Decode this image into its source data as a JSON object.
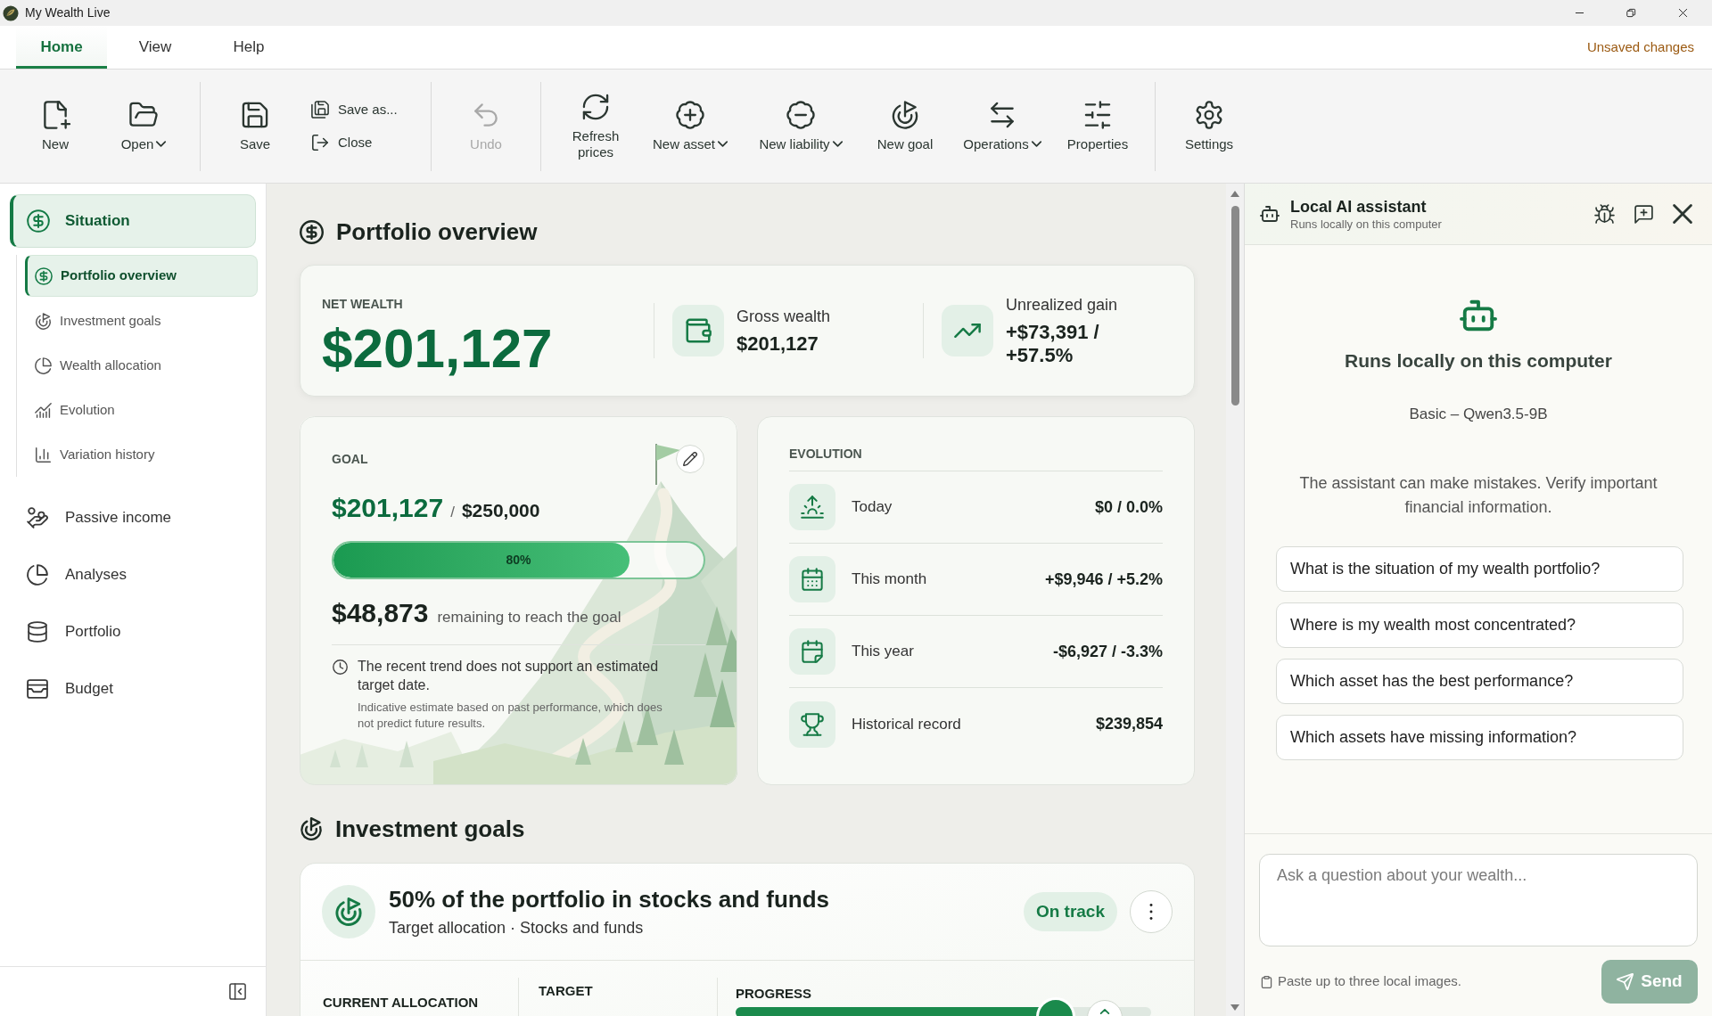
{
  "window": {
    "title": "My Wealth Live"
  },
  "tabs": [
    {
      "label": "Home",
      "selected": true
    },
    {
      "label": "View",
      "selected": false
    },
    {
      "label": "Help",
      "selected": false
    }
  ],
  "save_status": "Unsaved changes",
  "ribbon": [
    {
      "items": [
        {
          "kind": "large",
          "label": "New",
          "dropdown": false,
          "disabled": false
        },
        {
          "kind": "large",
          "label": "Open",
          "dropdown": true,
          "disabled": false
        }
      ]
    },
    {
      "items": [
        {
          "kind": "large",
          "label": "Save",
          "dropdown": false,
          "disabled": false
        },
        {
          "kind": "stack",
          "buttons": [
            {
              "label": "Save as...",
              "disabled": false
            },
            {
              "label": "Close",
              "disabled": false
            }
          ]
        }
      ]
    },
    {
      "items": [
        {
          "kind": "large",
          "label": "Undo",
          "dropdown": false,
          "disabled": true
        }
      ]
    },
    {
      "items": [
        {
          "kind": "large",
          "label": "Refresh prices",
          "dropdown": false,
          "disabled": false
        },
        {
          "kind": "large",
          "label": "New asset",
          "dropdown": true,
          "disabled": false
        },
        {
          "kind": "large",
          "label": "New liability",
          "dropdown": true,
          "disabled": false
        },
        {
          "kind": "large",
          "label": "New goal",
          "dropdown": false,
          "disabled": false
        },
        {
          "kind": "large",
          "label": "Operations",
          "dropdown": true,
          "disabled": false
        },
        {
          "kind": "large",
          "label": "Properties",
          "dropdown": false,
          "disabled": false
        }
      ]
    },
    {
      "items": [
        {
          "kind": "large",
          "label": "Settings",
          "dropdown": false,
          "disabled": false
        }
      ]
    }
  ],
  "sidebar": {
    "items": [
      {
        "label": "Situation",
        "selected": true,
        "children": [
          {
            "label": "Portfolio overview",
            "selected": true
          },
          {
            "label": "Investment goals",
            "selected": false
          },
          {
            "label": "Wealth allocation",
            "selected": false
          },
          {
            "label": "Evolution",
            "selected": false
          },
          {
            "label": "Variation history",
            "selected": false
          }
        ]
      },
      {
        "label": "Passive income",
        "selected": false
      },
      {
        "label": "Analyses",
        "selected": false
      },
      {
        "label": "Portfolio",
        "selected": false
      },
      {
        "label": "Budget",
        "selected": false
      }
    ]
  },
  "overview": {
    "heading": "Portfolio overview",
    "net_wealth": {
      "label": "NET WEALTH",
      "value": "$201,127"
    },
    "stats": [
      {
        "label": "Gross wealth",
        "value": "$201,127"
      },
      {
        "label": "Unrealized gain",
        "value": "+$73,391 / +57.5%"
      }
    ]
  },
  "goal": {
    "title": "GOAL",
    "current": "$201,127",
    "separator": "/",
    "target": "$250,000",
    "level": 0.8,
    "percent": "80%",
    "remaining": "$48,873",
    "remaining_text": "remaining to reach the goal",
    "note": "The recent trend does not support an estimated target date.",
    "disclaimer": "Indicative estimate based on past performance, which does not predict future results."
  },
  "evolution": {
    "title": "EVOLUTION",
    "rows": [
      {
        "label": "Today",
        "value": "$0 / 0.0%"
      },
      {
        "label": "This month",
        "value": "+$9,946 / +5.2%"
      },
      {
        "label": "This year",
        "value": "-$6,927 / -3.3%"
      },
      {
        "label": "Historical record",
        "value": "$239,854"
      }
    ]
  },
  "investment_goals": {
    "heading": "Investment goals",
    "goals": [
      {
        "title": "50% of the portfolio in stocks and funds",
        "subtitle": "Target allocation · Stocks and funds",
        "status": "On track",
        "columns": [
          "CURRENT ALLOCATION",
          "TARGET",
          "PROGRESS"
        ],
        "level": 0.77
      }
    ]
  },
  "assistant": {
    "title": "Local AI assistant",
    "subtitle": "Runs locally on this computer",
    "heading": "Runs locally on this computer",
    "model": "Basic – Qwen3.5-9B",
    "disclaimer": "The assistant can make mistakes. Verify important financial information.",
    "suggestions": [
      "What is the situation of my wealth portfolio?",
      "Where is my wealth most concentrated?",
      "Which asset has the best performance?",
      "Which assets have missing information?"
    ],
    "input": {
      "placeholder": "Ask a question about your wealth..."
    },
    "hint": "Paste up to three local images.",
    "send": {
      "label": "Send",
      "disabled": true
    }
  }
}
